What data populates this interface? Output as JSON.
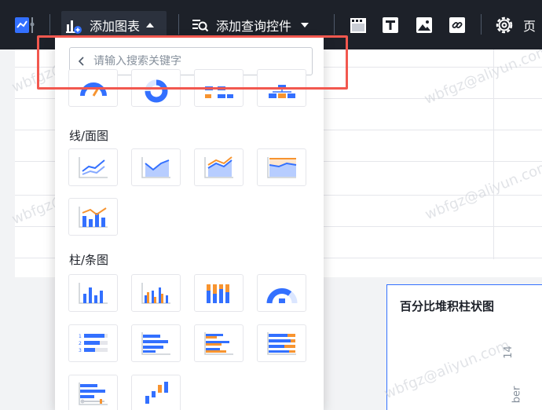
{
  "toolbar": {
    "add_chart": "添加图表",
    "add_query": "添加查询控件",
    "page_partial": "页"
  },
  "panel": {
    "search": {
      "placeholder": "请输入搜索关键字",
      "value": ""
    },
    "sections": [
      {
        "title": "线/面图"
      },
      {
        "title": "柱/条图"
      }
    ]
  },
  "background": {
    "chart_title": "百分比堆积柱状图",
    "axis_fragment_1": "14",
    "axis_fragment_2": "ber"
  },
  "watermark": "wbfgz@aliyun.com",
  "colors": {
    "accent": "#3370ff",
    "secondary": "#f79430",
    "highlight": "#f2584f",
    "toolbar": "#1d2129"
  }
}
